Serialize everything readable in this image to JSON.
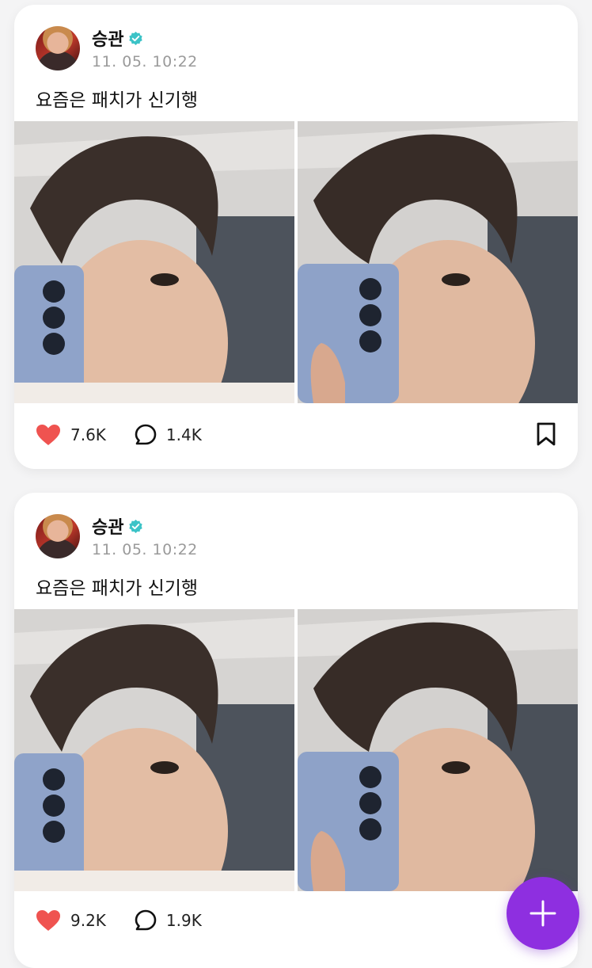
{
  "posts": [
    {
      "author": "승관",
      "time": "11. 05. 10:22",
      "caption": "요즘은 패치가 신기행",
      "likes": "7.6K",
      "comments": "1.4K"
    },
    {
      "author": "승관",
      "time": "11. 05. 10:22",
      "caption": "요즘은 패치가 신기행",
      "likes": "9.2K",
      "comments": "1.9K"
    }
  ],
  "icons": {
    "like": "heart-icon",
    "comment": "comment-bubble-icon",
    "save": "bookmark-icon",
    "verified": "verified-badge-icon",
    "compose": "plus-icon"
  },
  "colors": {
    "heart": "#ef5350",
    "verified": "#3cc3c7",
    "fab": "#8e2fe0"
  }
}
